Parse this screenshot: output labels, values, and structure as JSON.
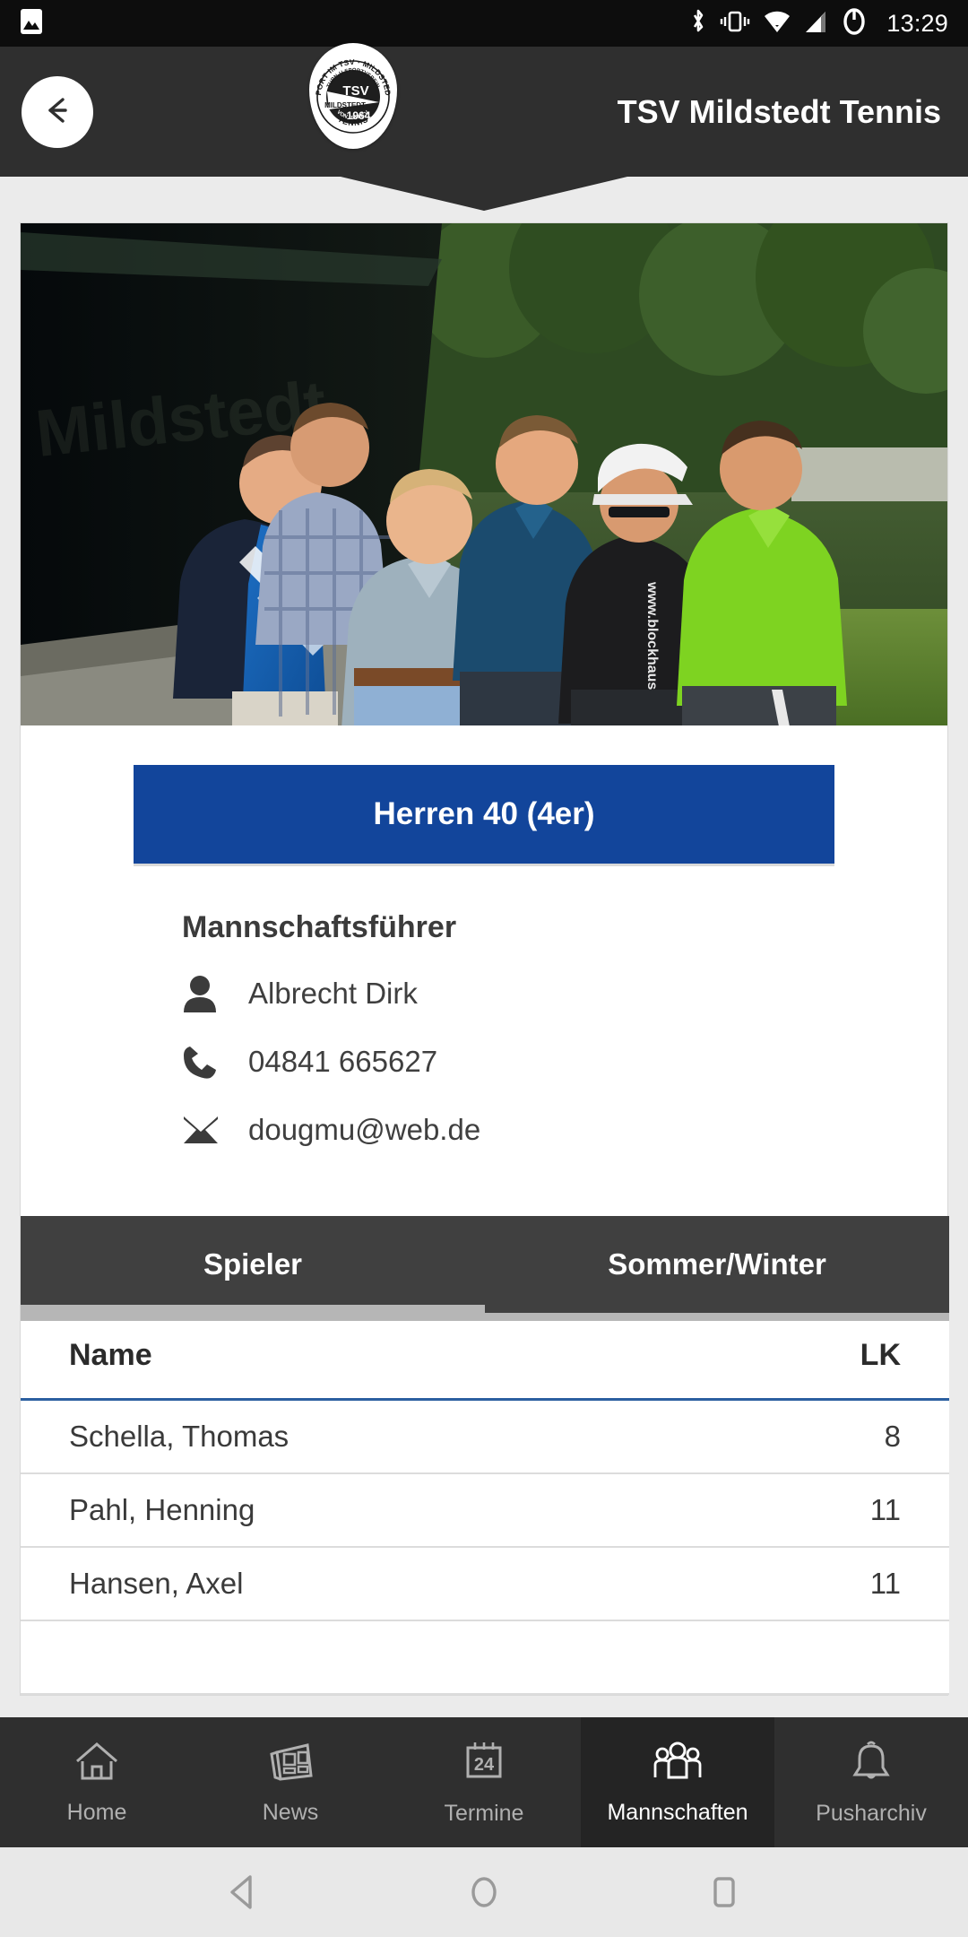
{
  "statusbar": {
    "time": "13:29",
    "left_icons": [
      "image-icon"
    ],
    "right_icons": [
      "bluetooth-icon",
      "vibrate-icon",
      "wifi-icon",
      "signal-icon",
      "battery-icon"
    ]
  },
  "appbar": {
    "back_label": "back-arrow",
    "title": "TSV Mildstedt Tennis",
    "logo": {
      "outer_top_text": "SPORT IM TSV · MILDSTEDT",
      "inner_top_text": "TURN-U.SPORTVEREIN",
      "center_text": "TSV",
      "center_sub": "MILDSTEDT",
      "year": "1964",
      "outer_sub": "VON 1964 E.V.",
      "outer_bottom_text": "TENNIS"
    }
  },
  "team": {
    "photo_alt": "team-photo",
    "button_label": "Herren 40 (4er)",
    "button_color": "#12459b"
  },
  "contact": {
    "heading": "Mannschaftsführer",
    "rows": [
      {
        "icon": "person-icon",
        "value": "Albrecht Dirk"
      },
      {
        "icon": "phone-icon",
        "value": "04841 665627"
      },
      {
        "icon": "mail-icon",
        "value": "dougmu@web.de"
      }
    ]
  },
  "tabs": {
    "items": [
      {
        "label": "Spieler",
        "active": true
      },
      {
        "label": "Sommer/Winter",
        "active": false
      }
    ]
  },
  "table": {
    "columns": [
      "Name",
      "LK"
    ],
    "rows": [
      {
        "name": "Schella, Thomas",
        "lk": "8"
      },
      {
        "name": "Pahl, Henning",
        "lk": "11"
      },
      {
        "name": "Hansen, Axel",
        "lk": "11"
      }
    ],
    "header_rule_color": "#2b5fa0"
  },
  "bottomnav": {
    "items": [
      {
        "label": "Home",
        "icon": "home-icon",
        "active": false
      },
      {
        "label": "News",
        "icon": "newspaper-icon",
        "active": false
      },
      {
        "label": "Termine",
        "icon": "calendar-icon",
        "active": false
      },
      {
        "label": "Mannschaften",
        "icon": "people-icon",
        "active": true
      },
      {
        "label": "Pusharchiv",
        "icon": "bell-icon",
        "active": false
      }
    ]
  },
  "androidnav": {
    "back": "triangle-back-icon",
    "home": "circle-home-icon",
    "recents": "square-recents-icon"
  }
}
